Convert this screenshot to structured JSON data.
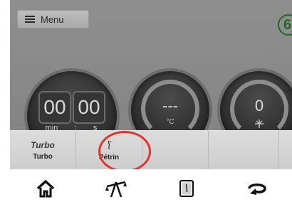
{
  "header": {
    "menu_label": "Menu",
    "step_number": "6"
  },
  "timer": {
    "minutes": "00",
    "seconds": "00",
    "min_unit": "min",
    "separator": ":",
    "sec_unit": "s"
  },
  "temperature": {
    "value": "---",
    "unit": "°C"
  },
  "speed": {
    "value": "0"
  },
  "functions": [
    {
      "logo": "Turbo",
      "label": "Turbo",
      "icon": "turbo-logo"
    },
    {
      "label": "Pétrin",
      "icon": "kneading-icon"
    },
    {
      "label": ""
    },
    {
      "label": ""
    }
  ],
  "navigation": [
    {
      "icon": "home-icon"
    },
    {
      "icon": "scale-icon"
    },
    {
      "icon": "recipe-book-icon"
    },
    {
      "icon": "reverse-rotation-icon"
    }
  ],
  "colors": {
    "highlight": "#e5332a",
    "step_badge": "#1f6b1f"
  }
}
